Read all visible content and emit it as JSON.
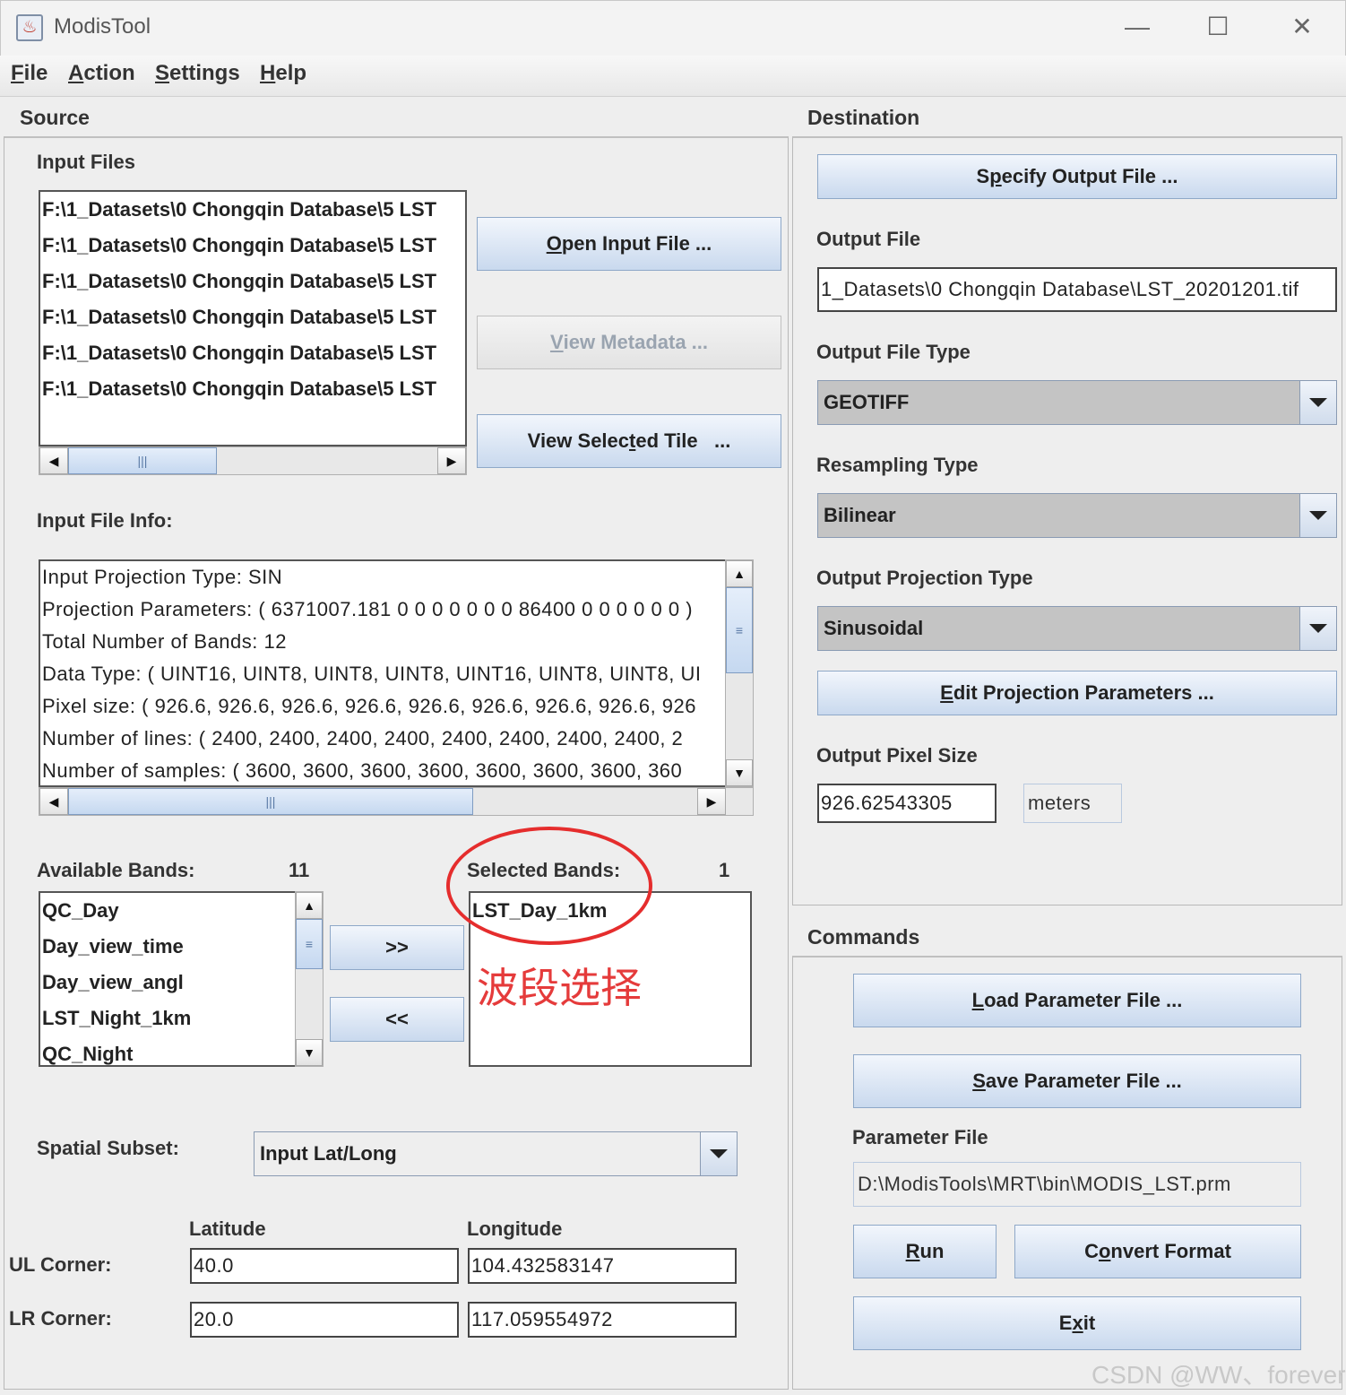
{
  "window": {
    "title": "ModisTool",
    "minimize": "—",
    "maximize": "☐",
    "close": "✕"
  },
  "menu": [
    {
      "first": "F",
      "rest": "ile"
    },
    {
      "first": "A",
      "rest": "ction"
    },
    {
      "first": "S",
      "rest": "ettings"
    },
    {
      "first": "H",
      "rest": "elp"
    }
  ],
  "source": {
    "header": "Source",
    "input_files_label": "Input Files",
    "input_files": [
      "F:\\1_Datasets\\0 Chongqin Database\\5 LST",
      "F:\\1_Datasets\\0 Chongqin Database\\5 LST",
      "F:\\1_Datasets\\0 Chongqin Database\\5 LST",
      "F:\\1_Datasets\\0 Chongqin Database\\5 LST",
      "F:\\1_Datasets\\0 Chongqin Database\\5 LST",
      "F:\\1_Datasets\\0 Chongqin Database\\5 LST"
    ],
    "open_input_btn": {
      "first": "O",
      "rest": "pen Input File ..."
    },
    "view_metadata_btn": {
      "first": "V",
      "rest": "iew Metadata ..."
    },
    "view_tile_btn": {
      "pre": "View Selec",
      "u": "t",
      "post": "ed Tile   ..."
    },
    "file_info_label": "Input File Info:",
    "file_info": [
      "Input Projection Type: SIN",
      "Projection Parameters: ( 6371007.181 0 0 0 0 0 0 0 86400 0 0 0 0 0 0 )",
      "Total Number of Bands: 12",
      "Data Type: ( UINT16, UINT8, UINT8, UINT8, UINT16, UINT8, UINT8, UI",
      "Pixel size: ( 926.6, 926.6, 926.6, 926.6, 926.6, 926.6, 926.6, 926.6, 926",
      "Number of lines: ( 2400, 2400, 2400, 2400, 2400, 2400, 2400, 2400, 2",
      "Number of samples: ( 3600, 3600, 3600, 3600, 3600, 3600, 3600, 360"
    ],
    "available_bands_label": "Available Bands:",
    "available_bands_count": "11",
    "available_bands": [
      "QC_Day",
      "Day_view_time",
      "Day_view_angl",
      "LST_Night_1km",
      "QC_Night"
    ],
    "add_btn": ">>",
    "remove_btn": "<<",
    "selected_bands_label": "Selected Bands:",
    "selected_bands_count": "1",
    "selected_bands": [
      "LST_Day_1km"
    ],
    "annotation": "波段选择",
    "spatial_subset_label": "Spatial Subset:",
    "spatial_subset_value": "Input Lat/Long",
    "latitude_label": "Latitude",
    "longitude_label": "Longitude",
    "ul_label": "UL Corner:",
    "lr_label": "LR Corner:",
    "ul_lat": "40.0",
    "ul_lon": "104.432583147",
    "lr_lat": "20.0",
    "lr_lon": "117.059554972"
  },
  "destination": {
    "header": "Destination",
    "specify_btn": {
      "pre": "S",
      "u": "p",
      "post": "ecify Output File ..."
    },
    "output_file_label": "Output File",
    "output_file": "1_Datasets\\0 Chongqin Database\\LST_20201201.tif",
    "output_type_label": "Output File Type",
    "output_type": "GEOTIFF",
    "resampling_label": "Resampling Type",
    "resampling": "Bilinear",
    "projection_label": "Output Projection Type",
    "projection": "Sinusoidal",
    "edit_proj_btn": {
      "first": "E",
      "rest": "dit Projection Parameters ..."
    },
    "pixel_size_label": "Output Pixel Size",
    "pixel_size": "926.62543305",
    "pixel_unit": "meters"
  },
  "commands": {
    "header": "Commands",
    "load_btn": {
      "first": "L",
      "rest": "oad Parameter File ..."
    },
    "save_btn": {
      "first": "S",
      "rest": "ave Parameter File ..."
    },
    "param_file_label": "Parameter File",
    "param_file": "D:\\ModisTools\\MRT\\bin\\MODIS_LST.prm",
    "run_btn": {
      "first": "R",
      "rest": "un"
    },
    "convert_btn": {
      "pre": "C",
      "u": "o",
      "post": "nvert Format"
    },
    "exit_btn": {
      "pre": "E",
      "u": "x",
      "post": "it"
    }
  },
  "watermark": "CSDN @WW、forever"
}
